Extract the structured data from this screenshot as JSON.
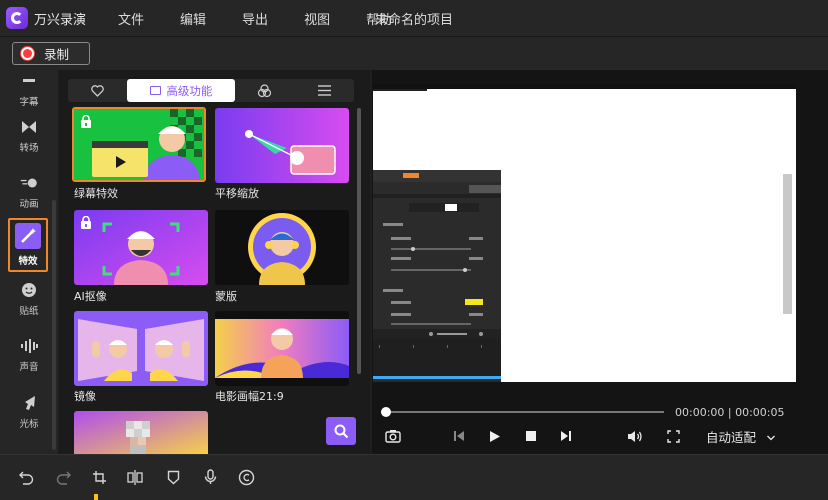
{
  "app": {
    "name": "万兴录演",
    "menu": [
      "文件",
      "编辑",
      "导出",
      "视图",
      "帮助"
    ],
    "document_title": "未命名的项目"
  },
  "record": {
    "label": "录制",
    "color": "#ff3b3b"
  },
  "sidebar": {
    "items": [
      {
        "label": "字幕",
        "icon": "subtitle-icon"
      },
      {
        "label": "转场",
        "icon": "transition-icon"
      },
      {
        "label": "动画",
        "icon": "animation-icon"
      },
      {
        "label": "特效",
        "icon": "effects-wand-icon",
        "active": true
      },
      {
        "label": "贴纸",
        "icon": "sticker-smile-icon"
      },
      {
        "label": "声音",
        "icon": "sound-wave-icon"
      },
      {
        "label": "光标",
        "icon": "cursor-icon"
      }
    ],
    "accent": "#f2862b"
  },
  "effects_panel": {
    "tabs": [
      {
        "label": "",
        "icon": "heart-icon"
      },
      {
        "label": "高级功能",
        "icon": "portrait-icon",
        "active": true
      },
      {
        "label": "",
        "icon": "color-circles-icon"
      },
      {
        "label": "",
        "icon": "list-icon"
      }
    ],
    "tiles": [
      {
        "label": "绿幕特效",
        "locked": true,
        "selected": true
      },
      {
        "label": "平移缩放",
        "locked": false
      },
      {
        "label": "AI抠像",
        "locked": true
      },
      {
        "label": "蒙版",
        "locked": false
      },
      {
        "label": "镜像",
        "locked": false
      },
      {
        "label": "电影画幅21:9",
        "locked": false
      },
      {
        "label": "",
        "locked": false
      }
    ],
    "accent": "#8b5cf6"
  },
  "preview": {
    "time_current": "00:00:00",
    "time_total": "00:00:05",
    "time_display": "00:00:00 | 00:00:05",
    "fit_label": "自动适配",
    "progress": 0
  },
  "bottom_tools": [
    "undo-icon",
    "redo-icon",
    "crop-icon",
    "split-icon",
    "shield-icon",
    "mic-icon",
    "copyright-icon"
  ]
}
